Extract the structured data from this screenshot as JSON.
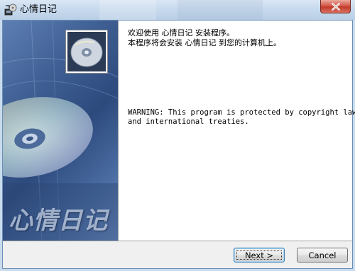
{
  "window": {
    "title": "心情日记",
    "icons": {
      "app": "installer-app-icon",
      "close": "close-icon"
    },
    "colors": {
      "title_bar": "#c9dbee",
      "close_button": "#c94535",
      "banner": "#3f5f94"
    }
  },
  "banner": {
    "logo_text": "心情日记",
    "icon": "cd-disc-image"
  },
  "content": {
    "icon": "cd-disc-icon",
    "welcome_line1": "欢迎使用 心情日记 安装程序。",
    "welcome_line2": "本程序将会安装 心情日记 到您的计算机上。",
    "warning_line1": "WARNING: This program is protected by copyright law",
    "warning_line2": "and international treaties."
  },
  "buttons": {
    "next_label": "Next >",
    "cancel_label": "Cancel"
  }
}
